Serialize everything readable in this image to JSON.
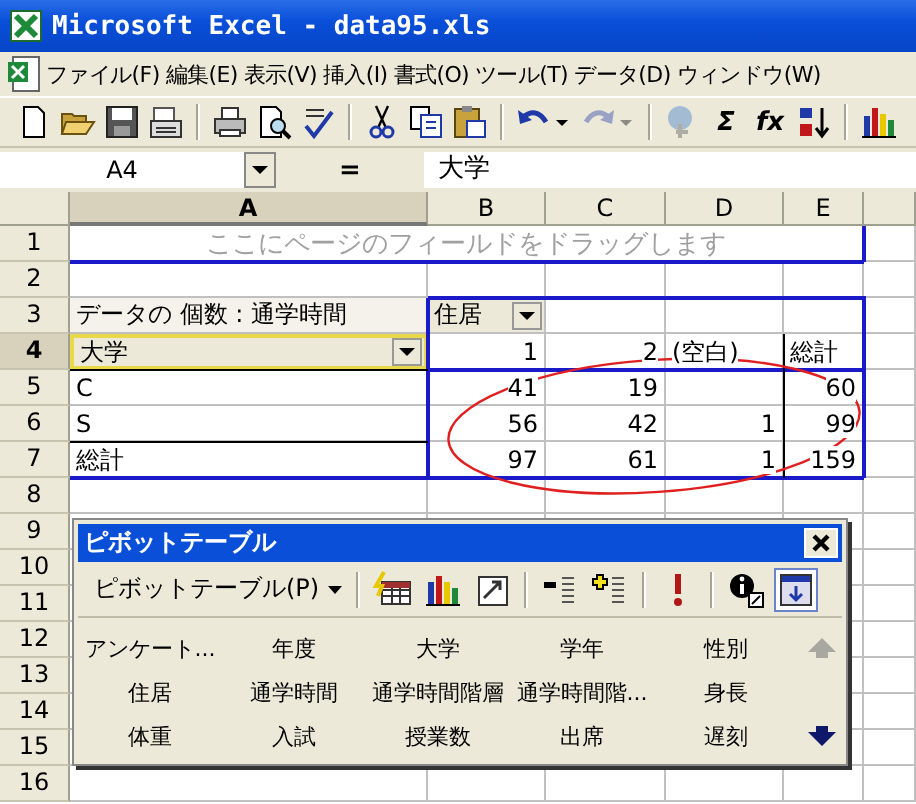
{
  "window": {
    "title": "Microsoft Excel - data95.xls"
  },
  "menu": [
    "ファイル(F)",
    "編集(E)",
    "表示(V)",
    "挿入(I)",
    "書式(O)",
    "ツール(T)",
    "データ(D)",
    "ウィンドウ(W)"
  ],
  "toolbar": [
    {
      "kind": "new",
      "disabled": false
    },
    {
      "kind": "open",
      "disabled": false
    },
    {
      "kind": "save",
      "disabled": false
    },
    {
      "kind": "mail",
      "disabled": false
    },
    {
      "kind": "sep"
    },
    {
      "kind": "print",
      "disabled": false
    },
    {
      "kind": "preview",
      "disabled": false
    },
    {
      "kind": "spell",
      "disabled": false
    },
    {
      "kind": "sep"
    },
    {
      "kind": "cut",
      "disabled": false
    },
    {
      "kind": "copy",
      "disabled": false
    },
    {
      "kind": "paste",
      "disabled": false
    },
    {
      "kind": "sep"
    },
    {
      "kind": "undo",
      "disabled": false
    },
    {
      "kind": "redo",
      "disabled": true
    },
    {
      "kind": "sep"
    },
    {
      "kind": "web",
      "disabled": true
    },
    {
      "kind": "glyph",
      "glyph": "Σ",
      "disabled": false
    },
    {
      "kind": "glyph",
      "glyph": "fx",
      "disabled": false
    },
    {
      "kind": "sort",
      "disabled": false
    },
    {
      "kind": "sep"
    },
    {
      "kind": "chart",
      "disabled": false
    }
  ],
  "formula_bar": {
    "name_box": "A4",
    "equals": "=",
    "value": "大学"
  },
  "sheet": {
    "columns": [
      {
        "label": "A",
        "selected": true
      },
      {
        "label": "B",
        "selected": false
      },
      {
        "label": "C",
        "selected": false
      },
      {
        "label": "D",
        "selected": false
      },
      {
        "label": "E",
        "selected": false
      }
    ],
    "rows": [
      {
        "label": "1",
        "selected": false,
        "cells": [
          {
            "kind": "hint",
            "text": "ここにページのフィールドをドラッグします",
            "selected": false
          }
        ]
      },
      {
        "label": "2",
        "selected": false
      },
      {
        "label": "3",
        "selected": false,
        "cells": [
          {
            "kind": "field",
            "text": "データの 個数 : 通学時間",
            "selected": false
          },
          {
            "kind": "dropdown",
            "text": "住居",
            "selected": false
          },
          {
            "kind": "empty",
            "selected": false
          },
          {
            "kind": "empty",
            "selected": false
          },
          {
            "kind": "empty",
            "selected": false
          }
        ]
      },
      {
        "label": "4",
        "selected": true,
        "cells": [
          {
            "kind": "dropdown",
            "text": "大学",
            "selected": true
          },
          {
            "kind": "number",
            "text": "1",
            "selected": false
          },
          {
            "kind": "number",
            "text": "2",
            "selected": false
          },
          {
            "kind": "label",
            "text": "(空白)",
            "selected": false
          },
          {
            "kind": "label",
            "text": "総計",
            "selected": false
          }
        ]
      },
      {
        "label": "5",
        "selected": false,
        "cells": [
          {
            "kind": "label",
            "text": "C",
            "selected": false
          },
          {
            "kind": "number",
            "text": "41",
            "selected": false
          },
          {
            "kind": "number",
            "text": "19",
            "selected": false
          },
          {
            "kind": "empty",
            "selected": false
          },
          {
            "kind": "number",
            "text": "60",
            "selected": false
          }
        ]
      },
      {
        "label": "6",
        "selected": false,
        "cells": [
          {
            "kind": "label",
            "text": "S",
            "selected": false
          },
          {
            "kind": "number",
            "text": "56",
            "selected": false
          },
          {
            "kind": "number",
            "text": "42",
            "selected": false
          },
          {
            "kind": "number",
            "text": "1",
            "selected": false
          },
          {
            "kind": "number",
            "text": "99",
            "selected": false
          }
        ]
      },
      {
        "label": "7",
        "selected": false,
        "cells": [
          {
            "kind": "label",
            "text": "総計",
            "selected": false
          },
          {
            "kind": "number",
            "text": "97",
            "selected": false
          },
          {
            "kind": "number",
            "text": "61",
            "selected": false
          },
          {
            "kind": "number",
            "text": "1",
            "selected": false
          },
          {
            "kind": "number",
            "text": "159",
            "selected": false
          }
        ]
      },
      {
        "label": "8",
        "selected": false
      },
      {
        "label": "9",
        "selected": false
      },
      {
        "label": "10",
        "selected": false
      },
      {
        "label": "11",
        "selected": false
      },
      {
        "label": "12",
        "selected": false
      },
      {
        "label": "13",
        "selected": false
      },
      {
        "label": "14",
        "selected": false
      },
      {
        "label": "15",
        "selected": false
      },
      {
        "label": "16",
        "selected": false
      }
    ]
  },
  "pivot_toolbar": {
    "title": "ピボットテーブル",
    "menu_button": "ピボットテーブル(P)",
    "tools": [
      {
        "kind": "format",
        "selected": false
      },
      {
        "kind": "chart",
        "selected": false
      },
      {
        "kind": "wizard",
        "selected": false
      },
      {
        "kind": "sep"
      },
      {
        "kind": "hide",
        "selected": false
      },
      {
        "kind": "show",
        "selected": false
      },
      {
        "kind": "sep"
      },
      {
        "kind": "refresh",
        "selected": false
      },
      {
        "kind": "sep"
      },
      {
        "kind": "settings",
        "selected": false
      },
      {
        "kind": "display",
        "selected": true
      }
    ],
    "fields": [
      "アンケート...",
      "年度",
      "大学",
      "学年",
      "性別",
      "住居",
      "通学時間",
      "通学時間階層",
      "通学時間階...",
      "身長",
      "体重",
      "入試",
      "授業数",
      "出席",
      "遅刻"
    ],
    "scroll_up": {
      "disabled": true
    },
    "scroll_down": {
      "disabled": false
    }
  }
}
